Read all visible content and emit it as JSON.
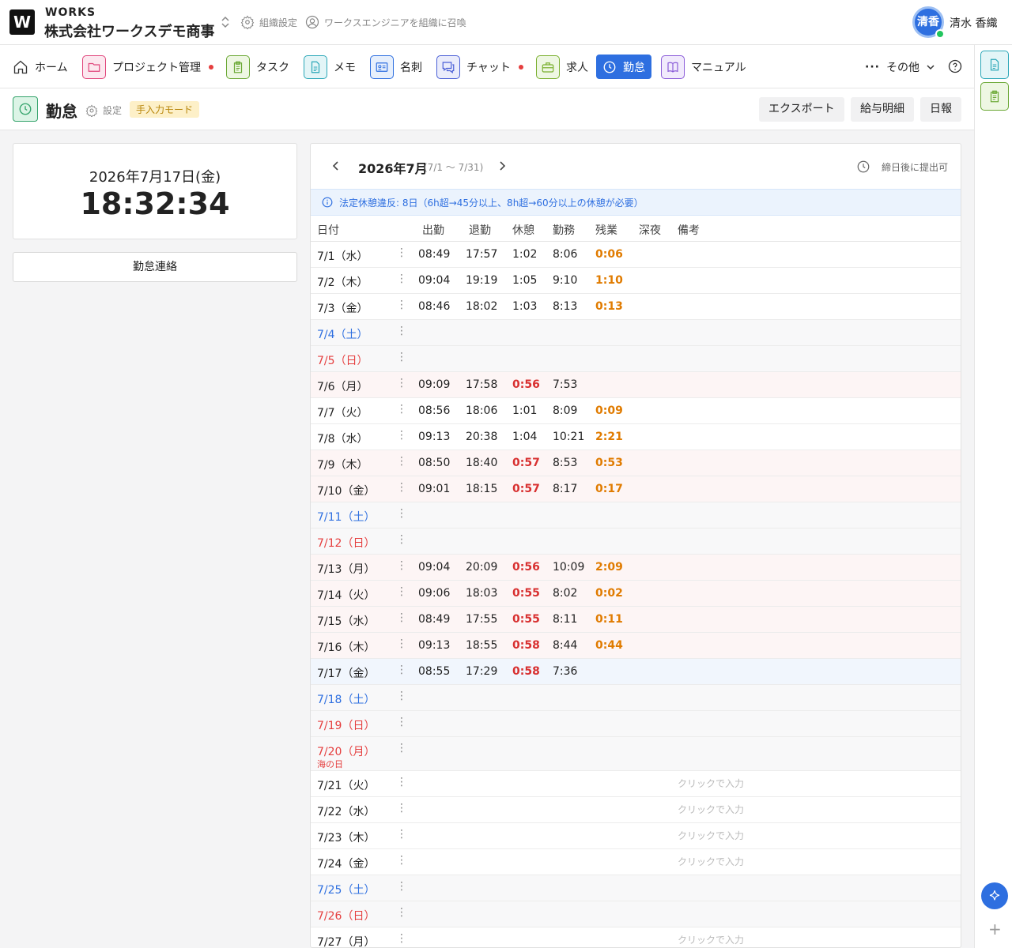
{
  "app": {
    "brand": "WORKS",
    "logo_letter": "W",
    "org_name": "株式会社ワークスデモ商事",
    "org_settings": "組織設定",
    "invite": "ワークスエンジニアを組織に召喚"
  },
  "user": {
    "avatar_text": "清香",
    "name": "清水 香織"
  },
  "nav": [
    {
      "label": "ホーム",
      "icon": "home-icon",
      "dot": false
    },
    {
      "label": "プロジェクト管理",
      "icon": "folder-icon",
      "dot": true,
      "color": "#e0457b"
    },
    {
      "label": "タスク",
      "icon": "clipboard-icon",
      "dot": false,
      "color": "#6aa834"
    },
    {
      "label": "メモ",
      "icon": "document-icon",
      "dot": false,
      "color": "#2ba7b8"
    },
    {
      "label": "名刺",
      "icon": "business-card-icon",
      "dot": false,
      "color": "#2e6fe0"
    },
    {
      "label": "チャット",
      "icon": "chat-icon",
      "dot": true,
      "color": "#4a5fd6"
    },
    {
      "label": "求人",
      "icon": "briefcase-icon",
      "dot": false,
      "color": "#7ab02f"
    },
    {
      "label": "勤怠",
      "icon": "clock-icon",
      "dot": false,
      "active": true
    },
    {
      "label": "マニュアル",
      "icon": "book-icon",
      "dot": false,
      "color": "#8a5bd8"
    }
  ],
  "nav_more": "その他",
  "page": {
    "title": "勤怠",
    "settings": "設定",
    "mode_badge": "手入力モード",
    "export": "エクスポート",
    "payslip": "給与明細",
    "daily": "日報"
  },
  "clock": {
    "date": "2026年7月17日(金)",
    "time": "18:32:34",
    "contact_button": "勤怠連絡"
  },
  "calendar": {
    "month": "2026年7月",
    "range": "(7/1 〜 7/31)",
    "deadline": "締日後に提出可",
    "warning": "法定休憩違反: 8日（6h超→45分以上、8h超→60分以上の休憩が必要）",
    "headers": {
      "date": "日付",
      "in": "出勤",
      "out": "退勤",
      "break": "休憩",
      "work": "勤務",
      "ot": "残業",
      "night": "深夜",
      "note": "備考"
    },
    "placeholder": "クリックで入力",
    "rows": [
      {
        "date": "7/1（水）",
        "in": "08:49",
        "out": "17:57",
        "brk": "1:02",
        "work": "8:06",
        "ot": "0:06",
        "type": "wk"
      },
      {
        "date": "7/2（木）",
        "in": "09:04",
        "out": "19:19",
        "brk": "1:05",
        "work": "9:10",
        "ot": "1:10",
        "type": "wk"
      },
      {
        "date": "7/3（金）",
        "in": "08:46",
        "out": "18:02",
        "brk": "1:03",
        "work": "8:13",
        "ot": "0:13",
        "type": "wk"
      },
      {
        "date": "7/4（土）",
        "type": "sat"
      },
      {
        "date": "7/5（日）",
        "type": "sun"
      },
      {
        "date": "7/6（月）",
        "in": "09:09",
        "out": "17:58",
        "brk": "0:56",
        "work": "7:53",
        "ot": "",
        "type": "viol"
      },
      {
        "date": "7/7（火）",
        "in": "08:56",
        "out": "18:06",
        "brk": "1:01",
        "work": "8:09",
        "ot": "0:09",
        "type": "wk"
      },
      {
        "date": "7/8（水）",
        "in": "09:13",
        "out": "20:38",
        "brk": "1:04",
        "work": "10:21",
        "ot": "2:21",
        "type": "wk"
      },
      {
        "date": "7/9（木）",
        "in": "08:50",
        "out": "18:40",
        "brk": "0:57",
        "work": "8:53",
        "ot": "0:53",
        "type": "viol"
      },
      {
        "date": "7/10（金）",
        "in": "09:01",
        "out": "18:15",
        "brk": "0:57",
        "work": "8:17",
        "ot": "0:17",
        "type": "viol"
      },
      {
        "date": "7/11（土）",
        "type": "sat"
      },
      {
        "date": "7/12（日）",
        "type": "sun"
      },
      {
        "date": "7/13（月）",
        "in": "09:04",
        "out": "20:09",
        "brk": "0:56",
        "work": "10:09",
        "ot": "2:09",
        "type": "viol"
      },
      {
        "date": "7/14（火）",
        "in": "09:06",
        "out": "18:03",
        "brk": "0:55",
        "work": "8:02",
        "ot": "0:02",
        "type": "viol"
      },
      {
        "date": "7/15（水）",
        "in": "08:49",
        "out": "17:55",
        "brk": "0:55",
        "work": "8:11",
        "ot": "0:11",
        "type": "viol"
      },
      {
        "date": "7/16（木）",
        "in": "09:13",
        "out": "18:55",
        "brk": "0:58",
        "work": "8:44",
        "ot": "0:44",
        "type": "viol"
      },
      {
        "date": "7/17（金）",
        "in": "08:55",
        "out": "17:29",
        "brk": "0:58",
        "work": "7:36",
        "ot": "",
        "type": "today"
      },
      {
        "date": "7/18（土）",
        "type": "sat"
      },
      {
        "date": "7/19（日）",
        "type": "sun"
      },
      {
        "date": "7/20（月）",
        "holiday": "海の日",
        "type": "hol"
      },
      {
        "date": "7/21（火）",
        "type": "future"
      },
      {
        "date": "7/22（水）",
        "type": "future"
      },
      {
        "date": "7/23（木）",
        "type": "future"
      },
      {
        "date": "7/24（金）",
        "type": "future"
      },
      {
        "date": "7/25（土）",
        "type": "sat"
      },
      {
        "date": "7/26（日）",
        "type": "sun"
      },
      {
        "date": "7/27（月）",
        "type": "future"
      }
    ]
  }
}
